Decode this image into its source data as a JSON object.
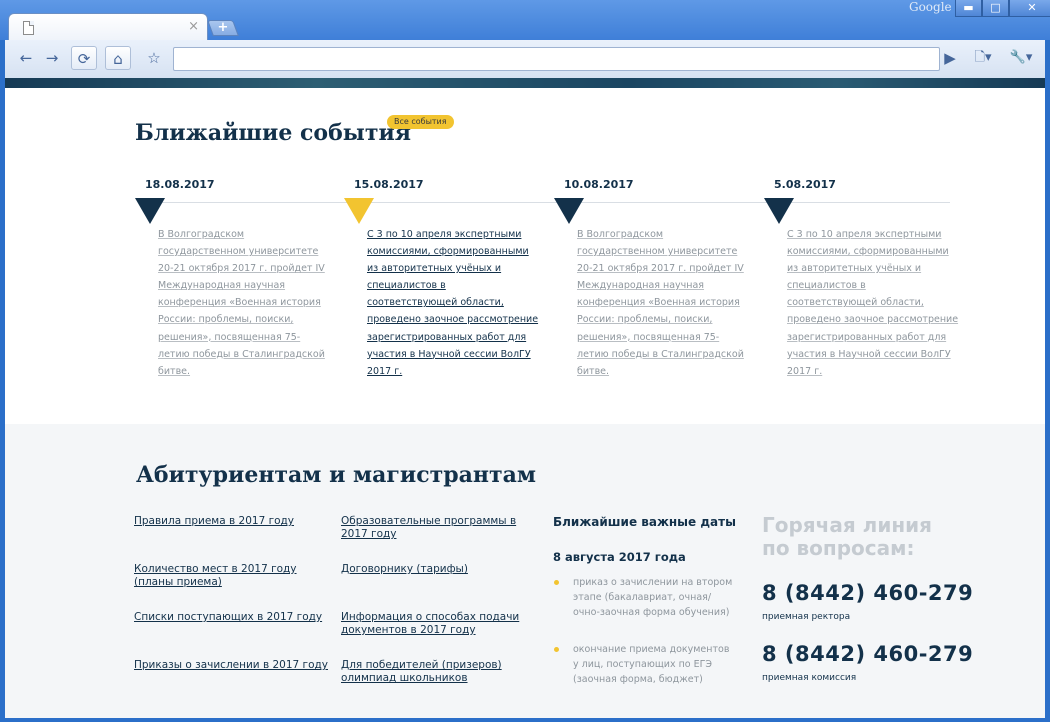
{
  "browser": {
    "brand": "Google",
    "tab_close": "×",
    "new_tab": "+",
    "window_buttons": {
      "minimize": "▬",
      "maximize": "□",
      "close": "✕"
    },
    "toolbar_icons": {
      "back": "←",
      "forward": "→",
      "reload": "⟳",
      "home": "⌂",
      "bookmark": "☆",
      "go": "▶",
      "page_menu": "🗋▾",
      "tools_menu": "🔧▾"
    }
  },
  "events": {
    "title": "Ближайшие события",
    "all_events_label": "Все события",
    "items": [
      {
        "date": "18.08.2017",
        "text": "В Волгоградском государственном университете 20-21 октября 2017 г. пройдет IV Международная научная конференция «Военная история России: проблемы, поиски, решения», посвященная 75-летию победы в Сталинградской битве."
      },
      {
        "date": "15.08.2017",
        "text": "С 3 по 10 апреля экспертными комиссиями, сформированными из авторитетных учёных и специалистов в соответствующей области, проведено заочное рассмотрение зарегистрированных работ для участия в Научной сессии ВолГУ 2017 г."
      },
      {
        "date": "10.08.2017",
        "text": "В Волгоградском государственном университете 20-21 октября 2017 г. пройдет IV Международная научная конференция «Военная история России: проблемы, поиски, решения», посвященная 75-летию победы в Сталинградской битве."
      },
      {
        "date": "5.08.2017",
        "text": "С 3 по 10 апреля экспертными комиссиями, сформированными из авторитетных учёных и специалистов в соответствующей области, проведено заочное рассмотрение зарегистрированных работ для участия в Научной сессии ВолГУ 2017 г."
      }
    ]
  },
  "applicants": {
    "title": "Абитуриентам и магистрантам",
    "links_col1": [
      "Правила приема в 2017 году",
      "Количество мест в 2017 году (планы приема)",
      "Списки поступающих в 2017 году",
      "Приказы о зачислении в 2017 году"
    ],
    "links_col2": [
      "Образовательные программы в 2017 году",
      "Договорнику (тарифы)",
      "Информация о способах подачи документов в 2017 году",
      "Для победителей (призеров) олимпиад школьников"
    ],
    "important_dates": {
      "title": "Ближайшие важные даты",
      "date": "8 августа 2017 года",
      "items": [
        "приказ о зачислении на втором этапе (бакалавриат, очная/очно-заочная форма обучения)",
        "окончание приема документов у лиц, поступающих по ЕГЭ (заочная форма, бюджет)"
      ]
    },
    "hotline": {
      "title": "Горячая линия по вопросам:",
      "phones": [
        {
          "number": "8 (8442) 460-279",
          "caption": "приемная ректора"
        },
        {
          "number": "8 (8442) 460-279",
          "caption": "приемная комиссия"
        }
      ]
    }
  },
  "colors": {
    "navy": "#13314a",
    "accent_yellow": "#f2c430",
    "muted_text": "#8e969d",
    "frame_blue": "#2b6fc9"
  }
}
